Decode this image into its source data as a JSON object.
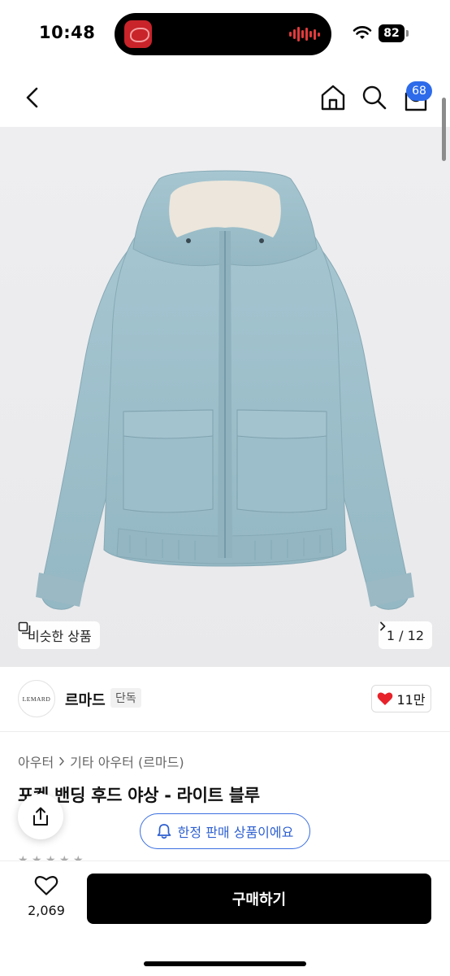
{
  "status_bar": {
    "time": "10:48",
    "battery": "82"
  },
  "nav": {
    "cart_count": "68"
  },
  "gallery": {
    "similar_label": "비슷한 상품",
    "counter": "1 / 12"
  },
  "shop": {
    "logo_text": "LEMARD",
    "name": "르마드",
    "badge": "단독",
    "likes": "11만"
  },
  "product": {
    "breadcrumb": [
      "아우터",
      "기타 아우터 (르마드)"
    ],
    "title": "포켓 밴딩 후드 야상 - 라이트 블루",
    "limited_notice": "한정 판매 상품이에요"
  },
  "bottom_bar": {
    "wish_count": "2,069",
    "buy_label": "구매하기"
  },
  "colors": {
    "accent_blue": "#2d6bea",
    "like_red": "#e8222a",
    "jacket": "#9dbfcb",
    "buy_button": "#000000"
  }
}
